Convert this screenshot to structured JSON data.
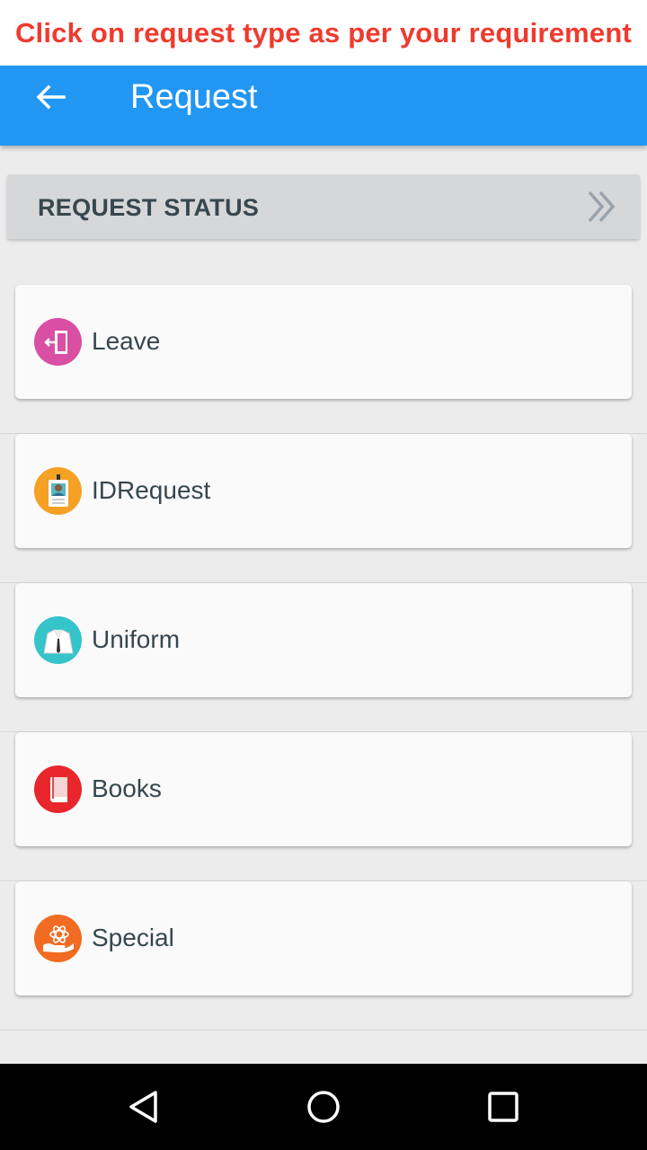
{
  "banner": {
    "text": "Click on request type as per your requirement",
    "color": "#f03a2e"
  },
  "appbar": {
    "title": "Request",
    "back_icon": "arrow-left-icon",
    "color": "#2196f3"
  },
  "request_status": {
    "label": "REQUEST STATUS",
    "icon": "double-chevron-right-icon"
  },
  "request_types": [
    {
      "label": "Leave",
      "icon": "door-exit-icon",
      "color": "#d94fa3"
    },
    {
      "label": "IDRequest",
      "icon": "id-card-icon",
      "color": "#f4a124"
    },
    {
      "label": "Uniform",
      "icon": "uniform-icon",
      "color": "#35c4c9"
    },
    {
      "label": "Books",
      "icon": "book-icon",
      "color": "#e8262c"
    },
    {
      "label": "Special",
      "icon": "special-hand-icon",
      "color": "#f26b22"
    }
  ],
  "navbar": {
    "back": "triangle-back-icon",
    "home": "circle-home-icon",
    "recents": "square-recents-icon"
  }
}
